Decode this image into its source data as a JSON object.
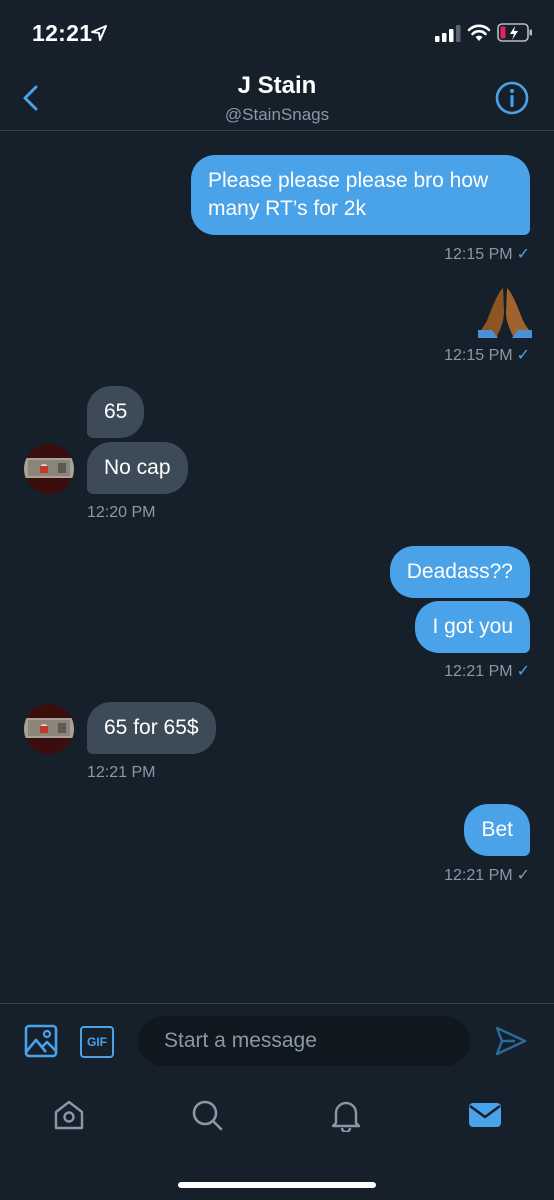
{
  "status_bar": {
    "time": "12:21",
    "icons": [
      "location-arrow-icon",
      "signal-icon",
      "wifi-icon",
      "battery-icon"
    ]
  },
  "header": {
    "name": "J Stain",
    "handle": "@StainSnags",
    "back_icon": "chevron-left-icon",
    "info_icon": "info-icon"
  },
  "messages": [
    {
      "side": "out",
      "text": "Please please please bro how many RT’s for 2k"
    },
    {
      "side": "out",
      "meta": "12:15 PM"
    },
    {
      "side": "out",
      "text": "🙏🏾"
    },
    {
      "side": "out",
      "meta": "12:15 PM"
    },
    {
      "side": "in",
      "text": "65"
    },
    {
      "side": "in",
      "text": "No cap"
    },
    {
      "side": "in",
      "meta": "12:20 PM"
    },
    {
      "side": "out",
      "text": "Deadass??"
    },
    {
      "side": "out",
      "text": "I got you"
    },
    {
      "side": "out",
      "meta": "12:21 PM"
    },
    {
      "side": "in",
      "text": "65 for 65$"
    },
    {
      "side": "in",
      "meta": "12:21 PM"
    },
    {
      "side": "out",
      "text": "Bet"
    },
    {
      "side": "out",
      "meta": "12:21 PM"
    }
  ],
  "read_check": "✓",
  "composer": {
    "placeholder": "Start a message",
    "gif_label": "GIF"
  },
  "tabs": [
    "home-icon",
    "search-icon",
    "notifications-icon",
    "messages-icon"
  ],
  "colors": {
    "background": "#15202b",
    "accent": "#4aa3e8",
    "incoming_bubble": "#3d4a58",
    "secondary_text": "#8899a6",
    "battery_low": "#e0245e"
  }
}
